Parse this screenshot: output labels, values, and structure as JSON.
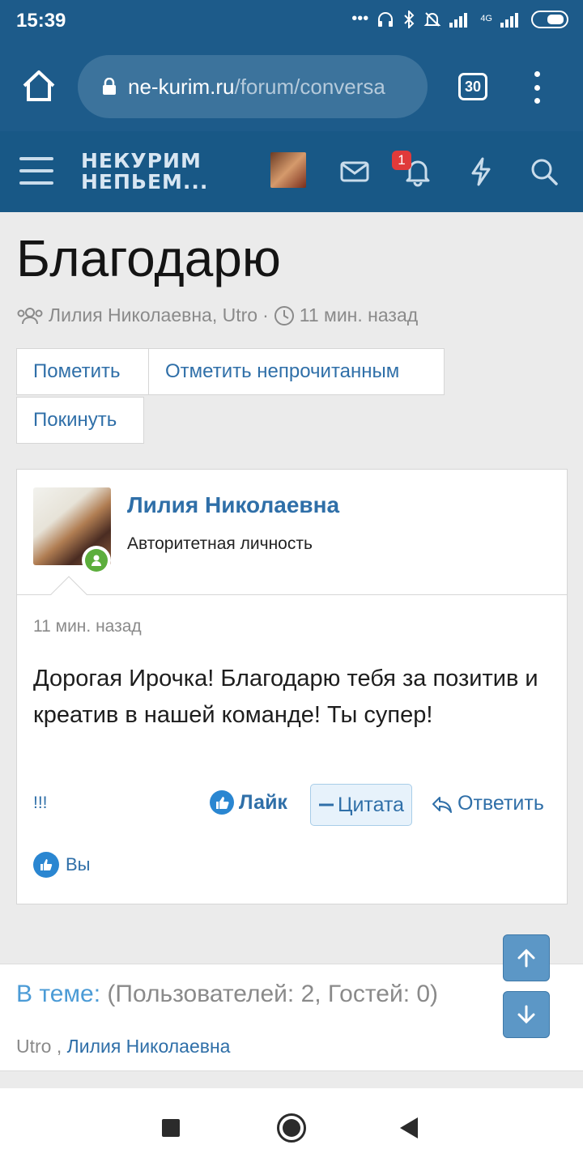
{
  "status_bar": {
    "time": "15:39",
    "network_label": "4G"
  },
  "browser": {
    "url_domain": "ne-kurim.ru",
    "url_path": "/forum/conversa",
    "tab_count": "30"
  },
  "site_header": {
    "logo_line1": "НЕКУРИМ",
    "logo_line2": "НЕПЬЕМ...",
    "alert_count": "1"
  },
  "page": {
    "title": "Благодарю",
    "participants": "Лилия Николаевна, Utro",
    "separator": "·",
    "time_ago": "11 мин. назад"
  },
  "actions": {
    "mark": "Пометить",
    "mark_unread": "Отметить непрочитанным",
    "leave": "Покинуть"
  },
  "message": {
    "author": "Лилия Николаевна",
    "rank": "Авторитетная личность",
    "time": "11 мин. назад",
    "body": "Дорогая Ирочка! Благодарю тебя за позитив и креатив в нашей команде! Ты супер!",
    "report_label": "!!!",
    "like_label": "Лайк",
    "quote_label": "Цитата",
    "reply_label": "Ответить",
    "likes_by": "Вы"
  },
  "in_thread": {
    "label": "В теме:",
    "stats": "(Пользователей: 2, Гостей: 0)",
    "user1": "Utro",
    "comma": " , ",
    "user2": "Лилия Николаевна"
  },
  "colors": {
    "header_bg": "#185886",
    "link": "#2f6fa8",
    "badge": "#e03a3a",
    "online": "#5cae3c"
  }
}
